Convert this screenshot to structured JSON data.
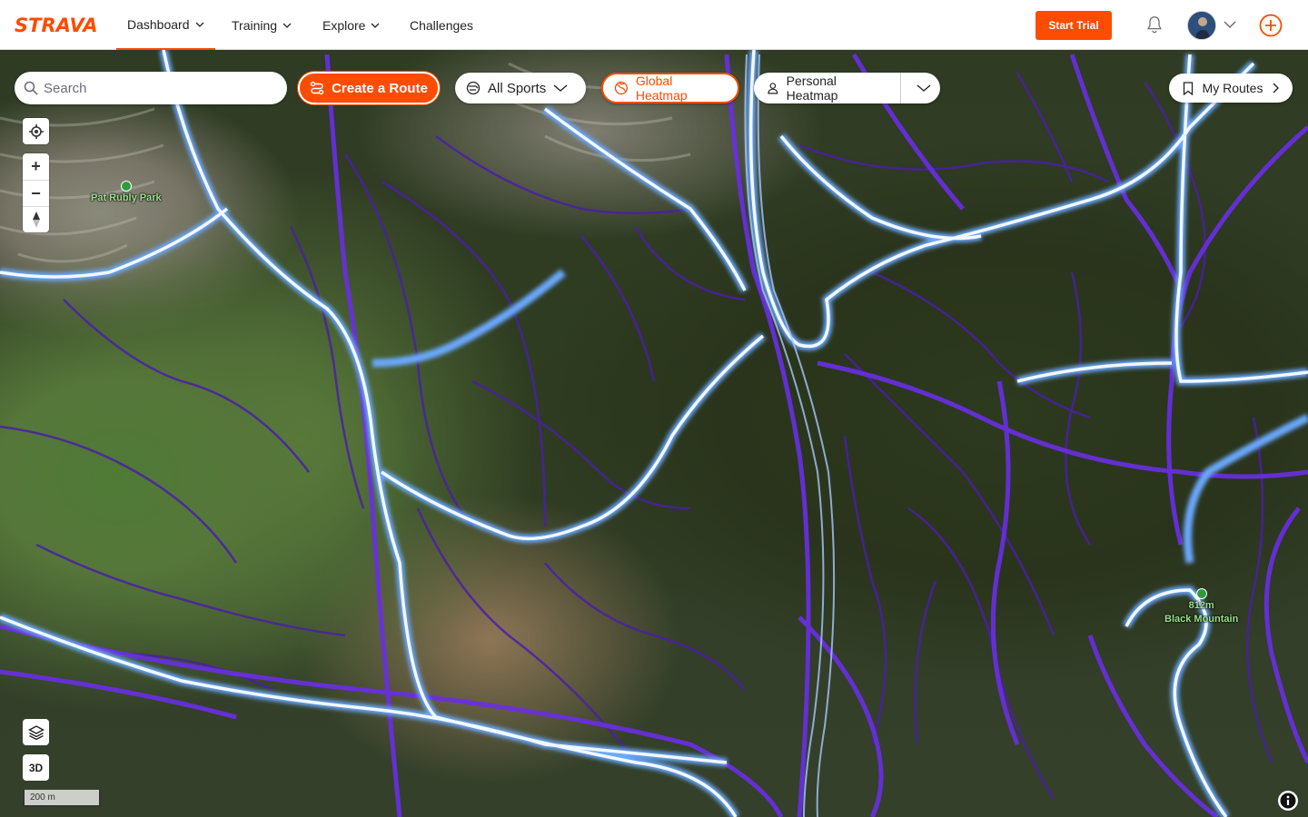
{
  "brand": {
    "logo_text": "STRAVA",
    "accent": "#fc4c02"
  },
  "nav": {
    "items": [
      {
        "label": "Dashboard",
        "has_dropdown": true,
        "active": true
      },
      {
        "label": "Training",
        "has_dropdown": true
      },
      {
        "label": "Explore",
        "has_dropdown": true
      },
      {
        "label": "Challenges",
        "has_dropdown": false
      }
    ],
    "start_trial": "Start Trial",
    "icons": [
      "bell-icon",
      "avatar",
      "chevron-down-icon",
      "plus-circle-icon"
    ]
  },
  "toolbar": {
    "search_placeholder": "Search",
    "create_route": "Create a Route",
    "sport_filter": "All Sports",
    "global_heatmap": "Global Heatmap",
    "personal_heatmap": "Personal Heatmap",
    "my_routes": "My Routes"
  },
  "map_controls": {
    "locate": "locate-icon",
    "zoom_in": "+",
    "zoom_out": "−",
    "compass": "compass-icon",
    "layers": "layers-icon",
    "three_d": "3D",
    "scale": "200 m",
    "info": "info-icon"
  },
  "pois": [
    {
      "name": "Pat Rubly Park",
      "icon": "park-icon"
    },
    {
      "name": "Black Mountain",
      "elevation": "812m",
      "icon": "peak-icon"
    }
  ],
  "heatmap_colors": {
    "hot": "#f2f8ff",
    "warm": "#6aa9ff",
    "cool": "#5b2bd6",
    "faint": "#3b1a7a"
  }
}
